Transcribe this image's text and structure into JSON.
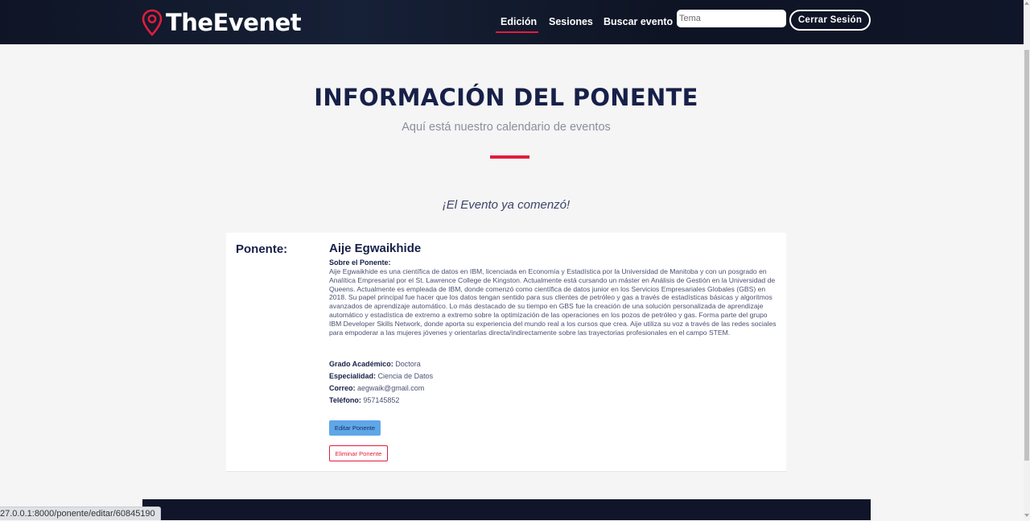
{
  "header": {
    "brand": "TheEvenet",
    "nav": {
      "edicion": "Edición",
      "sesiones": "Sesiones",
      "buscar": "Buscar evento"
    },
    "search_placeholder": "Tema",
    "logout": "Cerrar Sesión"
  },
  "main": {
    "title": "INFORMACIÓN DEL PONENTE",
    "subtitle": "Aquí está nuestro calendario de eventos",
    "event_status": "¡El Evento ya comenzó!"
  },
  "speaker": {
    "label": "Ponente:",
    "name": "Aije Egwaikhide",
    "about_label": "Sobre el Ponente:",
    "about": "Aije Egwaikhide es una científica de datos en IBM, licenciada en Economía y Estadística por la Universidad de Manitoba y con un posgrado en Analítica Empresarial por el St. Lawrence College de Kingston. Actualmente está cursando un máster en Análisis de Gestión en la Universidad de Queens. Actualmente es empleada de IBM, donde comenzó como científica de datos junior en los Servicios Empresariales Globales (GBS) en 2018. Su papel principal fue hacer que los datos tengan sentido para sus clientes de petróleo y gas a través de estadísticas básicas y algoritmos avanzados de aprendizaje automático. Lo más destacado de su tiempo en GBS fue la creación de una solución personalizada de aprendizaje automático y estadística de extremo a extremo sobre la optimización de las operaciones en los pozos de petróleo y gas. Forma parte del grupo IBM Developer Skills Network, donde aporta su experiencia del mundo real a los cursos que crea. Aije utiliza su voz a través de las redes sociales para empoderar a las mujeres jóvenes y orientarlas directa/indirectamente sobre las trayectorias profesionales en el campo STEM.",
    "degree_label": "Grado Académico:",
    "degree": "Doctora",
    "specialty_label": "Especialidad:",
    "specialty": "Ciencia de Datos",
    "email_label": "Correo:",
    "email": "aegwaik@gmail.com",
    "phone_label": "Teléfono:",
    "phone": "957145852",
    "edit_button": "Editar Ponente",
    "delete_button": "Eliminar Ponente"
  },
  "status_bar": {
    "url": "27.0.0.1:8000/ponente/editar/60845190"
  },
  "colors": {
    "accent": "#e31c3d",
    "navy": "#172048",
    "edit_button": "#5fa7e8"
  }
}
